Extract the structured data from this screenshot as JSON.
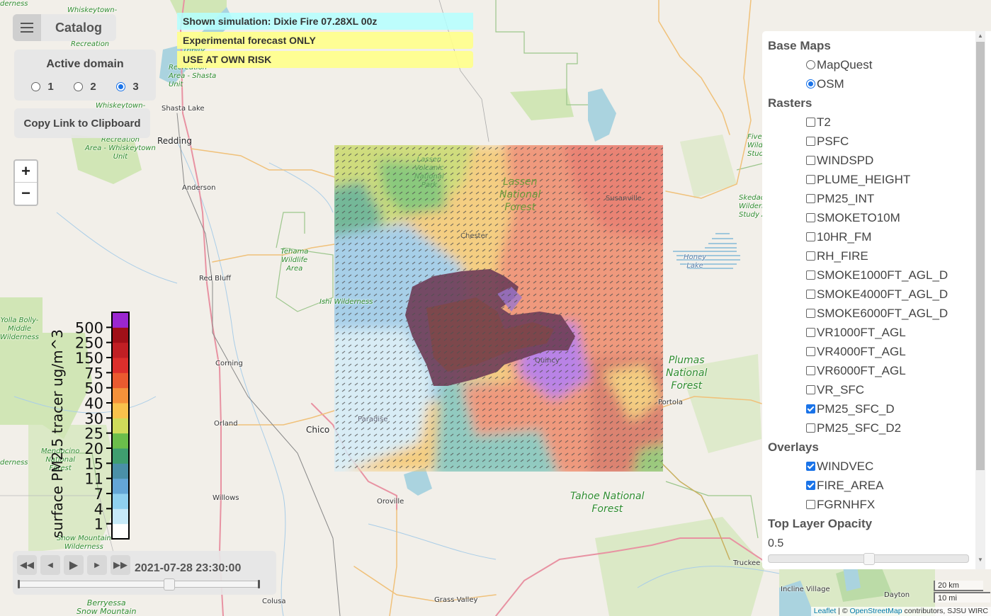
{
  "catalog": {
    "label": "Catalog",
    "menu_icon": "hamburger-icon"
  },
  "domain": {
    "title": "Active domain",
    "options": [
      {
        "label": "1",
        "selected": false
      },
      {
        "label": "2",
        "selected": false
      },
      {
        "label": "3",
        "selected": true
      }
    ]
  },
  "copy_link": {
    "label": "Copy Link to Clipboard"
  },
  "zoom": {
    "in_label": "+",
    "out_label": "−"
  },
  "banners": {
    "simulation": "Shown simulation: Dixie Fire 07.28XL 00z",
    "experimental": "Experimental forecast ONLY",
    "risk": "USE AT OWN RISK"
  },
  "colorbar": {
    "label": "surface PM2.5 tracer ug/m^3",
    "ticks": [
      "1",
      "4",
      "7",
      "11",
      "15",
      "20",
      "25",
      "30",
      "40",
      "50",
      "75",
      "150",
      "250",
      "500"
    ],
    "colors": [
      "#ffffff",
      "#c6e9f8",
      "#8fd0ef",
      "#64a6d6",
      "#4a90a8",
      "#3f9e6f",
      "#6bbd4b",
      "#cfdb5a",
      "#f9c24c",
      "#f5913a",
      "#ea5a2f",
      "#dc2f2c",
      "#c01f24",
      "#a01018",
      "#9b27d0"
    ]
  },
  "time": {
    "buttons": [
      "first-frame",
      "previous-frame",
      "play",
      "next-frame",
      "last-frame"
    ],
    "timestamp": "2021-07-28 23:30:00",
    "slider_fraction": 0.63
  },
  "layers": {
    "base_maps_title": "Base Maps",
    "base_maps": [
      {
        "label": "MapQuest",
        "selected": false
      },
      {
        "label": "OSM",
        "selected": true
      }
    ],
    "rasters_title": "Rasters",
    "rasters": [
      {
        "label": "T2",
        "checked": false
      },
      {
        "label": "PSFC",
        "checked": false
      },
      {
        "label": "WINDSPD",
        "checked": false
      },
      {
        "label": "PLUME_HEIGHT",
        "checked": false
      },
      {
        "label": "PM25_INT",
        "checked": false
      },
      {
        "label": "SMOKETO10M",
        "checked": false
      },
      {
        "label": "10HR_FM",
        "checked": false
      },
      {
        "label": "RH_FIRE",
        "checked": false
      },
      {
        "label": "SMOKE1000FT_AGL_D",
        "checked": false
      },
      {
        "label": "SMOKE4000FT_AGL_D",
        "checked": false
      },
      {
        "label": "SMOKE6000FT_AGL_D",
        "checked": false
      },
      {
        "label": "VR1000FT_AGL",
        "checked": false
      },
      {
        "label": "VR4000FT_AGL",
        "checked": false
      },
      {
        "label": "VR6000FT_AGL",
        "checked": false
      },
      {
        "label": "VR_SFC",
        "checked": false
      },
      {
        "label": "PM25_SFC_D",
        "checked": true
      },
      {
        "label": "PM25_SFC_D2",
        "checked": false
      }
    ],
    "overlays_title": "Overlays",
    "overlays": [
      {
        "label": "WINDVEC",
        "checked": true
      },
      {
        "label": "FIRE_AREA",
        "checked": true
      },
      {
        "label": "FGRNHFX",
        "checked": false
      }
    ],
    "opacity_title": "Top Layer Opacity",
    "opacity_value": "0.5",
    "opacity": 0.5
  },
  "map": {
    "places": [
      {
        "name": "Shasta Lake",
        "type": "city-small"
      },
      {
        "name": "Redding",
        "type": "city"
      },
      {
        "name": "Anderson",
        "type": "city-small"
      },
      {
        "name": "Red Bluff",
        "type": "city-small"
      },
      {
        "name": "Corning",
        "type": "city-small"
      },
      {
        "name": "Orland",
        "type": "city-small"
      },
      {
        "name": "Chico",
        "type": "city"
      },
      {
        "name": "Willows",
        "type": "city-small"
      },
      {
        "name": "Oroville",
        "type": "city-small"
      },
      {
        "name": "Colusa",
        "type": "city-small"
      },
      {
        "name": "Grass Valley",
        "type": "city-small"
      },
      {
        "name": "Truckee",
        "type": "city-small"
      },
      {
        "name": "Incline Village",
        "type": "city-small"
      },
      {
        "name": "Dayton",
        "type": "city-small"
      },
      {
        "name": "Portola",
        "type": "city-small"
      },
      {
        "name": "Quincy",
        "type": "city-small"
      },
      {
        "name": "Chester",
        "type": "city-small"
      },
      {
        "name": "Susanville",
        "type": "city-small"
      },
      {
        "name": "Paradise",
        "type": "city-small"
      }
    ],
    "parks": [
      "Whiskeytown-",
      "Recreation",
      "Trinity",
      "Recreation\nArea - Shasta\nUnit",
      "Whiskeytown-",
      "Recreation\nArea - Whiskeytown\nUnit",
      "Tehama\nWildlife\nArea",
      "Ishi Wilderness",
      "Yolla Bolly-\nMiddle\nWilderness",
      "Mendocino\nNational\nForest",
      "Snow Mountain\nWilderness",
      "Berryessa\nSnow Mountain",
      "Lassen\nVolcanic\nNational\nPark",
      "Lassen\nNational\nForest",
      "Plumas\nNational\nForest",
      "Tahoe National\nForest",
      "Five\nWild\nStud",
      "Skedad\nWilderr\nStudy A",
      "derness",
      "derness"
    ],
    "water": [
      "Honey\nLake"
    ]
  },
  "scale": {
    "km": "20 km",
    "mi": "10 mi"
  },
  "attribution": {
    "leaflet": "Leaflet",
    "sep": " | © ",
    "osm": "OpenStreetMap",
    "rest": " contributors, SJSU WIRC"
  }
}
